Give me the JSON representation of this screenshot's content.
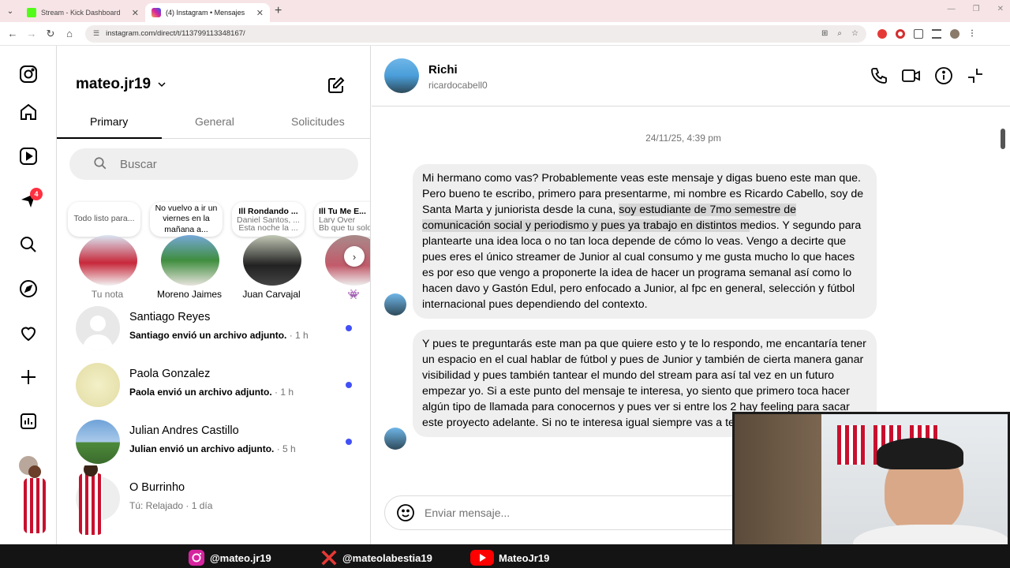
{
  "browser": {
    "tabs": [
      {
        "title": "Stream - Kick Dashboard",
        "active": false
      },
      {
        "title": "(4) Instagram • Mensajes",
        "active": true
      }
    ],
    "url": "instagram.com/direct/t/113799113348167/"
  },
  "sidebar": {
    "notifications_badge": "4"
  },
  "inbox": {
    "username": "mateo.jr19",
    "tabs": [
      "Primary",
      "General",
      "Solicitudes"
    ],
    "search_placeholder": "Buscar",
    "notes": [
      {
        "bubble_title": "",
        "bubble_text": "Todo listo para...",
        "name": "Tu nota"
      },
      {
        "bubble_title": "",
        "bubble_text": "No vuelvo a ir un viernes en la mañana a...",
        "name": "Moreno Jaimes"
      },
      {
        "bubble_title": "Ill Rondando ...",
        "bubble_text": "Daniel Santos, ...",
        "bubble_text2": "Esta noche la ...",
        "name": "Juan Carvajal"
      },
      {
        "bubble_title": "Ill Tu Me E...",
        "bubble_text": "Lary Over",
        "bubble_text2": "Bb que tu solo",
        "name": "👾"
      }
    ],
    "conversations": [
      {
        "name": "Santiago Reyes",
        "preview": "Santiago envió un archivo adjunto.",
        "time": "· 1 h",
        "unread": true
      },
      {
        "name": "Paola Gonzalez",
        "preview": "Paola envió un archivo adjunto.",
        "time": "· 1 h",
        "unread": true
      },
      {
        "name": "Julian Andres Castillo",
        "preview": "Julian envió un archivo adjunto.",
        "time": "· 5 h",
        "unread": true
      },
      {
        "name": "O Burrinho",
        "preview": "Tú: Relajado",
        "time": "· 1 día",
        "unread": false
      }
    ]
  },
  "chat": {
    "name": "Richi",
    "handle": "ricardocabell0",
    "timestamp": "24/11/25, 4:39 pm",
    "messages": [
      {
        "part1": "Mi hermano como vas? Probablemente veas este mensaje y digas bueno este man que. Pero bueno te escribo, primero para presentarme, mi nombre es Ricardo Cabello, soy de Santa Marta y juniorista desde la cuna, ",
        "highlight": "soy estudiante de 7mo semestre de comunicación social y periodismo y pues ya trabajo en distintos m",
        "part2": "edios. Y segundo para plantearte una idea loca o no tan loca depende de cómo lo veas. Vengo a decirte que pues eres el único streamer de Junior al cual consumo y me gusta mucho lo que haces es por eso que vengo a proponerte la idea de hacer un programa semanal así como lo hacen davo y Gastón Edul, pero enfocado a Junior, al fpc en general, selección y fútbol internacional pues dependiendo del contexto."
      },
      {
        "part1": "Y pues te preguntarás este man pa que quiere esto y te lo respondo, me encantaría tener un espacio en el cual hablar de fútbol y pues de Junior y también de cierta manera ganar visibilidad y pues también tantear el mundo del stream para así tal vez en un futuro empezar yo. Si a este punto del mensaje te interesa, yo siento que primero toca hacer algún tipo de llamada para conocernos y pues ver si entre los 2 hay feeling para sacar este proyecto adelante. Si no te intere",
        "highlight": "",
        "part2": "sa igual siempre vas a tener un viewer más."
      }
    ],
    "composer_placeholder": "Enviar mensaje..."
  },
  "stream_overlay": {
    "instagram": "@mateo.jr19",
    "x": "@mateolabestia19",
    "youtube": "MateoJr19"
  },
  "colors": {
    "unread_dot": "#4150f7",
    "badge": "#ff3040"
  }
}
